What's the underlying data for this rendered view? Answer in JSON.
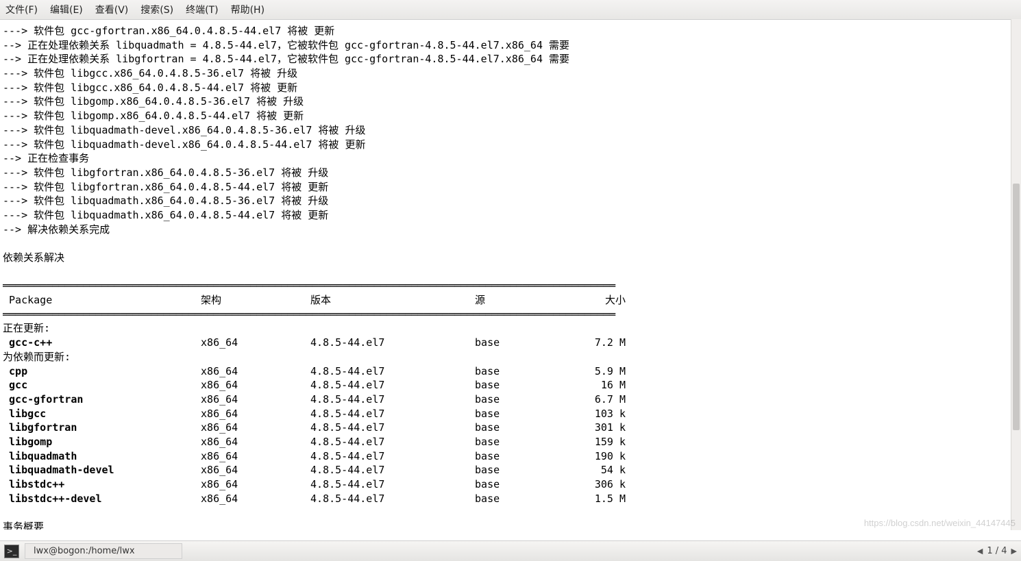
{
  "menubar": {
    "file": "文件(F)",
    "edit": "编辑(E)",
    "view": "查看(V)",
    "search": "搜索(S)",
    "terminal": "终端(T)",
    "help": "帮助(H)"
  },
  "terminal_lines": [
    "---> 软件包 gcc-gfortran.x86_64.0.4.8.5-44.el7 将被 更新",
    "--> 正在处理依赖关系 libquadmath = 4.8.5-44.el7，它被软件包 gcc-gfortran-4.8.5-44.el7.x86_64 需要",
    "--> 正在处理依赖关系 libgfortran = 4.8.5-44.el7，它被软件包 gcc-gfortran-4.8.5-44.el7.x86_64 需要",
    "---> 软件包 libgcc.x86_64.0.4.8.5-36.el7 将被 升级",
    "---> 软件包 libgcc.x86_64.0.4.8.5-44.el7 将被 更新",
    "---> 软件包 libgomp.x86_64.0.4.8.5-36.el7 将被 升级",
    "---> 软件包 libgomp.x86_64.0.4.8.5-44.el7 将被 更新",
    "---> 软件包 libquadmath-devel.x86_64.0.4.8.5-36.el7 将被 升级",
    "---> 软件包 libquadmath-devel.x86_64.0.4.8.5-44.el7 将被 更新",
    "--> 正在检查事务",
    "---> 软件包 libgfortran.x86_64.0.4.8.5-36.el7 将被 升级",
    "---> 软件包 libgfortran.x86_64.0.4.8.5-44.el7 将被 更新",
    "---> 软件包 libquadmath.x86_64.0.4.8.5-36.el7 将被 升级",
    "---> 软件包 libquadmath.x86_64.0.4.8.5-44.el7 将被 更新",
    "--> 解决依赖关系完成",
    "",
    "依赖关系解决",
    ""
  ],
  "table": {
    "headers": {
      "pkg": "Package",
      "arch": "架构",
      "ver": "版本",
      "repo": "源",
      "size": "大小"
    },
    "section_updating": "正在更新:",
    "section_deps": "为依赖而更新:",
    "updating": [
      {
        "pkg": "gcc-c++",
        "arch": "x86_64",
        "ver": "4.8.5-44.el7",
        "repo": "base",
        "size": "7.2 M"
      }
    ],
    "deps": [
      {
        "pkg": "cpp",
        "arch": "x86_64",
        "ver": "4.8.5-44.el7",
        "repo": "base",
        "size": "5.9 M"
      },
      {
        "pkg": "gcc",
        "arch": "x86_64",
        "ver": "4.8.5-44.el7",
        "repo": "base",
        "size": "16 M"
      },
      {
        "pkg": "gcc-gfortran",
        "arch": "x86_64",
        "ver": "4.8.5-44.el7",
        "repo": "base",
        "size": "6.7 M"
      },
      {
        "pkg": "libgcc",
        "arch": "x86_64",
        "ver": "4.8.5-44.el7",
        "repo": "base",
        "size": "103 k"
      },
      {
        "pkg": "libgfortran",
        "arch": "x86_64",
        "ver": "4.8.5-44.el7",
        "repo": "base",
        "size": "301 k"
      },
      {
        "pkg": "libgomp",
        "arch": "x86_64",
        "ver": "4.8.5-44.el7",
        "repo": "base",
        "size": "159 k"
      },
      {
        "pkg": "libquadmath",
        "arch": "x86_64",
        "ver": "4.8.5-44.el7",
        "repo": "base",
        "size": "190 k"
      },
      {
        "pkg": "libquadmath-devel",
        "arch": "x86_64",
        "ver": "4.8.5-44.el7",
        "repo": "base",
        "size": "54 k"
      },
      {
        "pkg": "libstdc++",
        "arch": "x86_64",
        "ver": "4.8.5-44.el7",
        "repo": "base",
        "size": "306 k"
      },
      {
        "pkg": "libstdc++-devel",
        "arch": "x86_64",
        "ver": "4.8.5-44.el7",
        "repo": "base",
        "size": "1.5 M"
      }
    ],
    "footer_partial": "事务概要"
  },
  "divider_thin": "───────────────────────────────────────────────────────────────────────────────────────────────────",
  "divider_thick": "═══════════════════════════════════════════════════════════════════════════════════════════════════",
  "watermark": "https://blog.csdn.net/weixin_44147445",
  "taskbar": {
    "window_title": "lwx@bogon:/home/lwx",
    "pager": "1 / 4"
  }
}
